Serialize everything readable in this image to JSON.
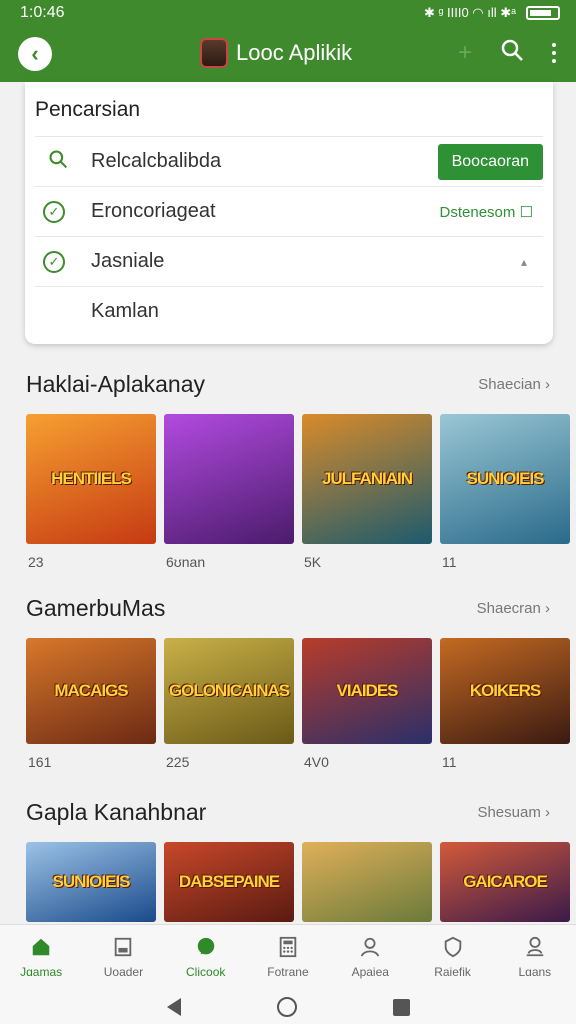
{
  "status_bar": {
    "time": "1:0:46",
    "icons_text": "✱ ᵍ ΙΙΙΙ0 ◠ ıll ✱ᵃ"
  },
  "header": {
    "title": "Looc Aplikik",
    "back_icon": "back-arrow-icon",
    "actions": [
      "add-icon",
      "search-icon",
      "more-vert-icon"
    ]
  },
  "search_card": {
    "title": "Pencarsian",
    "rows": [
      {
        "label": "Relcalcbalibda",
        "action": "Boocaoran",
        "icon": "search-icon"
      },
      {
        "label": "Eroncoriageat",
        "action": "Dstenesom ☐",
        "icon": "check-circle-icon"
      },
      {
        "label": "Jasniale",
        "action": "▴",
        "icon": "check-circle-icon"
      },
      {
        "label": "Kamlan",
        "action": "",
        "icon": "red-apple-icon"
      }
    ]
  },
  "sections": [
    {
      "title": "Haklai-Aplakanay",
      "more": "Shaecian ›",
      "items": [
        {
          "thumb": "HENTIIELS",
          "count": "23",
          "colors": [
            "#c53a12",
            "#f6a032"
          ]
        },
        {
          "thumb": "",
          "count": "6ʊnan",
          "colors": [
            "#4a1c6b",
            "#b24be0"
          ]
        },
        {
          "thumb": "JULFANIAIN",
          "count": "5K",
          "colors": [
            "#1c5a6e",
            "#d98b2a"
          ]
        },
        {
          "thumb": "SUNIOIEIS",
          "count": "11",
          "colors": [
            "#2a6a8a",
            "#9ac7d4"
          ]
        }
      ]
    },
    {
      "title": "GamerbuMas",
      "more": "Shaecran ›",
      "items": [
        {
          "thumb": "MACAIGS",
          "count": "161",
          "colors": [
            "#6b2a14",
            "#d8782a"
          ]
        },
        {
          "thumb": "GOLONICAINAS",
          "count": "225",
          "colors": [
            "#6a5a18",
            "#c9b048"
          ]
        },
        {
          "thumb": "VIAIDES",
          "count": "4V0",
          "colors": [
            "#2a2f6a",
            "#b83c2a"
          ]
        },
        {
          "thumb": "KOIKERS",
          "count": "11",
          "colors": [
            "#3a1a12",
            "#c46a22"
          ]
        }
      ]
    },
    {
      "title": "Gapla Kanahbnar",
      "more": "Shesuam ›",
      "items": [
        {
          "thumb": "SUNIOIEIS",
          "count": "",
          "colors": [
            "#1a4a8a",
            "#9cc2e6"
          ]
        },
        {
          "thumb": "DABSEPAINE",
          "count": "",
          "colors": [
            "#5a1a12",
            "#c8482a"
          ]
        },
        {
          "thumb": "",
          "count": "",
          "colors": [
            "#6a7a3a",
            "#e0b05a"
          ]
        },
        {
          "thumb": "GAICAROE",
          "count": "",
          "colors": [
            "#3a1a4a",
            "#d25a3a"
          ]
        }
      ]
    }
  ],
  "bottom_nav": [
    {
      "label": "Jɑamas",
      "icon": "home-icon",
      "active": true
    },
    {
      "label": "Uoader",
      "icon": "document-icon",
      "active": false
    },
    {
      "label": "Clicook",
      "icon": "chat-icon",
      "active": true
    },
    {
      "label": "Fotrane",
      "icon": "calculator-icon",
      "active": false
    },
    {
      "label": "Apaiea",
      "icon": "person-icon",
      "active": false
    },
    {
      "label": "Raiefik",
      "icon": "shield-icon",
      "active": false
    },
    {
      "label": "Lɑans",
      "icon": "account-icon",
      "active": false
    }
  ]
}
